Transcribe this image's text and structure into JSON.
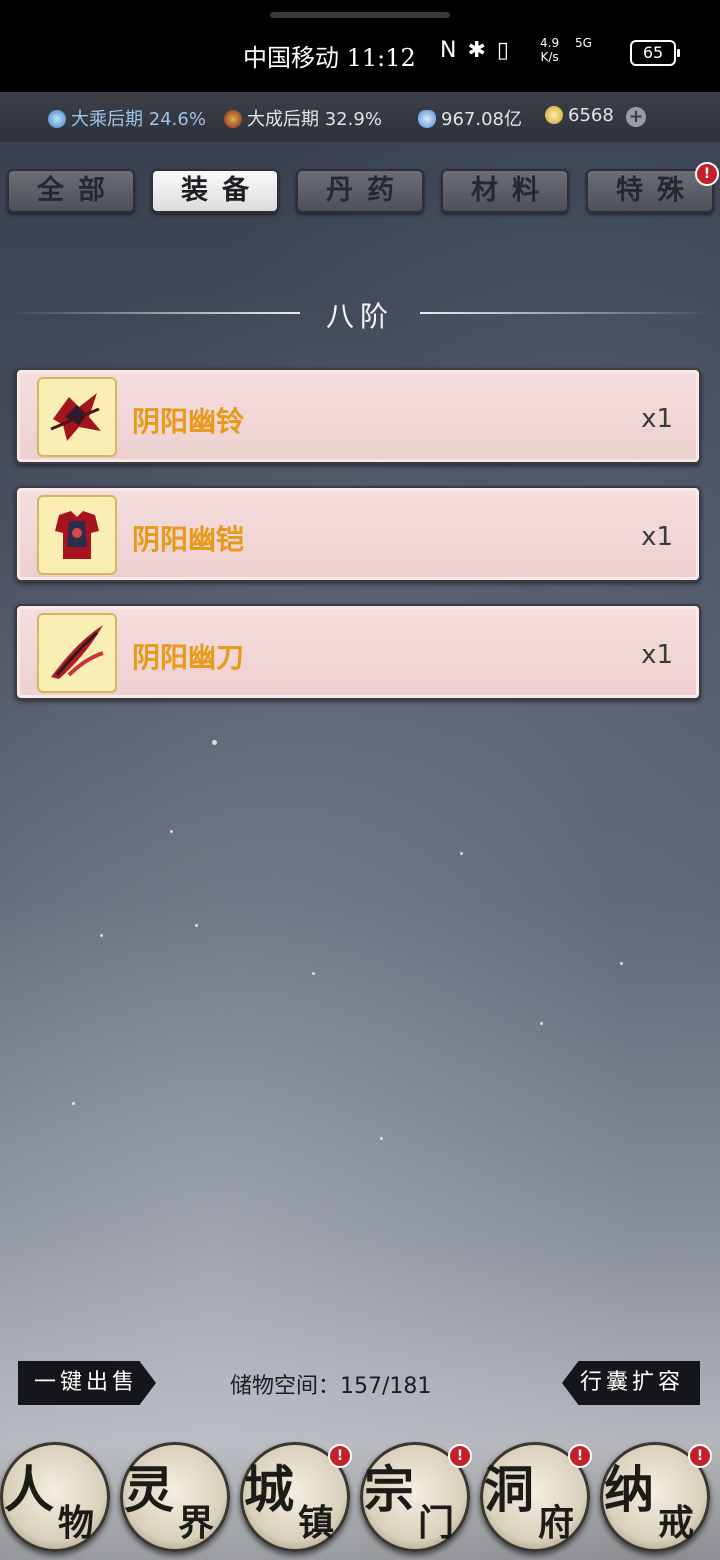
{
  "status_bar": {
    "carrier_time": "中国移动 11:12",
    "icons": "N ✱ ▯",
    "speed_top": "4.9",
    "speed_bottom": "K/s",
    "network": "5G",
    "battery": "65"
  },
  "resources": {
    "realm1": {
      "name": "大乘后期",
      "value": "24.6%"
    },
    "realm2": {
      "name": "大成后期",
      "value": "32.9%"
    },
    "spirit_stones": "967.08亿",
    "gold": "6568",
    "add_label": "+"
  },
  "tabs": [
    {
      "label": "全部",
      "active": false
    },
    {
      "label": "装备",
      "active": true
    },
    {
      "label": "丹药",
      "active": false
    },
    {
      "label": "材料",
      "active": false
    },
    {
      "label": "特殊",
      "active": false,
      "badge": "!"
    }
  ],
  "section_title": "八阶",
  "items": [
    {
      "name": "阴阳幽铃",
      "qty": "x1"
    },
    {
      "name": "阴阳幽铠",
      "qty": "x1"
    },
    {
      "name": "阴阳幽刀",
      "qty": "x1"
    }
  ],
  "footer": {
    "sell_label": "一键出售",
    "storage": "储物空间：157/181",
    "expand_label": "行囊扩容"
  },
  "nav": [
    {
      "c1": "人",
      "c2": "物",
      "badge": null
    },
    {
      "c1": "灵",
      "c2": "界",
      "badge": null
    },
    {
      "c1": "城",
      "c2": "镇",
      "badge": "!"
    },
    {
      "c1": "宗",
      "c2": "门",
      "badge": "!"
    },
    {
      "c1": "洞",
      "c2": "府",
      "badge": "!"
    },
    {
      "c1": "纳",
      "c2": "戒",
      "badge": "!"
    }
  ],
  "colors": {
    "item_name": "#e79a18",
    "badge": "#c3202a",
    "tab_active": "#fafafa"
  }
}
